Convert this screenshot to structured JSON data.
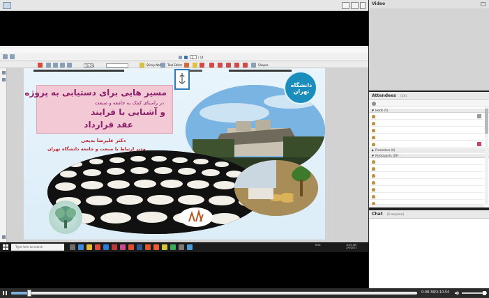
{
  "video_pod": {
    "title": "Video"
  },
  "attendees_pod": {
    "title": "Attendees",
    "count": "(34)",
    "sections": {
      "hosts": "Hosts (5)",
      "presenters": "Presenters (0)",
      "participants": "Participants (29)"
    }
  },
  "chat_pod": {
    "title": "Chat",
    "scope": "(Everyone)"
  },
  "playback": {
    "time": "0:08:38/3:10:54",
    "progress": 0.045,
    "volume": 0.9
  },
  "taskbar": {
    "search_placeholder": "Type here to search",
    "tray_time": "8:05 AM",
    "tray_date": "2/9/2021",
    "tray_lang": "ENG"
  },
  "viewer": {
    "zoom": "70.5%",
    "page_current": "1",
    "page_total": "/ 14",
    "toolbar_labels": {
      "sticky_note": "Sticky Note",
      "text_editor": "Text Editor",
      "shapes": "Shapes"
    }
  },
  "slide": {
    "title_line1": "مسیر هایی  برای دستیابی به پروژه ها",
    "title_line2": "در راستای کمک به جامعه و صنعت",
    "title_line3": "و آشنایی با فرایند",
    "title_line4": "عقد قرارداد",
    "author": "دکتر علیرضا بدیعی",
    "position": "مدیر ارتباط با صنعت و جامعه دانشگاه تهران",
    "logo_text": "دانشگاه تهران"
  },
  "colors": {
    "slide_title": "#8c1f6a",
    "slide_author": "#c41f2a",
    "title_box": "#f2c9d5",
    "logo_blue": "#1a8dbd"
  }
}
